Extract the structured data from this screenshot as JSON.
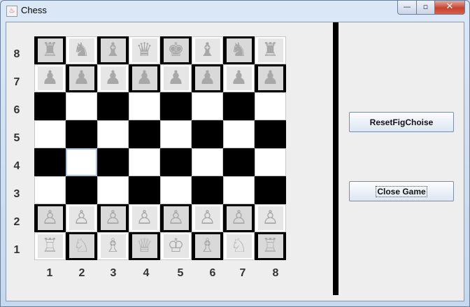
{
  "window": {
    "title": "Chess",
    "icon": "java-icon"
  },
  "controls": {
    "minimize": "—",
    "maximize": "▫",
    "close": "✕"
  },
  "ranks": [
    "8",
    "7",
    "6",
    "5",
    "4",
    "3",
    "2",
    "1"
  ],
  "files": [
    "1",
    "2",
    "3",
    "4",
    "5",
    "6",
    "7",
    "8"
  ],
  "board": [
    [
      "♜",
      "♞",
      "♝",
      "♛",
      "♚",
      "♝",
      "♞",
      "♜"
    ],
    [
      "♟",
      "♟",
      "♟",
      "♟",
      "♟",
      "♟",
      "♟",
      "♟"
    ],
    [
      "",
      "",
      "",
      "",
      "",
      "",
      "",
      ""
    ],
    [
      "",
      "",
      "",
      "",
      "",
      "",
      "",
      ""
    ],
    [
      "",
      "",
      "",
      "",
      "",
      "",
      "",
      ""
    ],
    [
      "",
      "",
      "",
      "",
      "",
      "",
      "",
      ""
    ],
    [
      "♙",
      "♙",
      "♙",
      "♙",
      "♙",
      "♙",
      "♙",
      "♙"
    ],
    [
      "♖",
      "♘",
      "♗",
      "♕",
      "♔",
      "♗",
      "♘",
      "♖"
    ]
  ],
  "piece_names": {
    "♜": "rook",
    "♞": "knight",
    "♝": "bishop",
    "♛": "queen",
    "♚": "king",
    "♟": "pawn",
    "♖": "rook",
    "♘": "knight",
    "♗": "bishop",
    "♕": "queen",
    "♔": "king",
    "♙": "pawn"
  },
  "buttons": {
    "reset": "ResetFigChoise",
    "close_game": "Close Game"
  }
}
